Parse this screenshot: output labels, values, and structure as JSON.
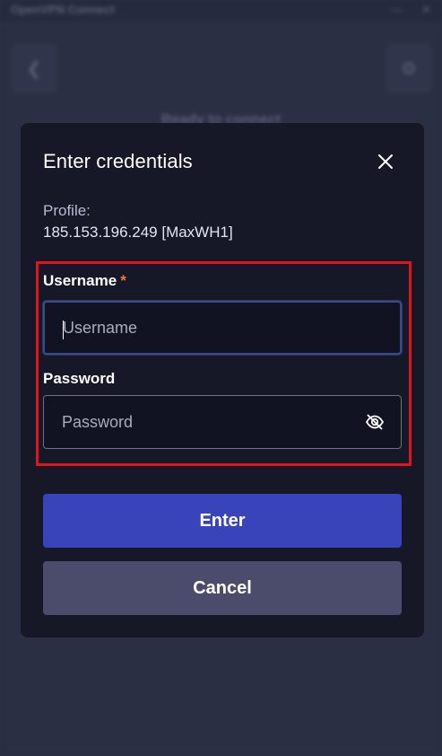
{
  "background": {
    "app_title": "OpenVPN Connect",
    "minimize_glyph": "—",
    "close_glyph": "✕",
    "back_glyph": "❮",
    "settings_glyph": "⚙",
    "heading": "Ready to connect"
  },
  "dialog": {
    "title": "Enter credentials",
    "profile_label": "Profile:",
    "profile_value": "185.153.196.249 [MaxWH1]",
    "username": {
      "label": "Username",
      "required_mark": "*",
      "value": "",
      "placeholder": "Username"
    },
    "password": {
      "label": "Password",
      "value": "",
      "placeholder": "Password"
    },
    "enter_button": "Enter",
    "cancel_button": "Cancel"
  },
  "colors": {
    "dialog_bg": "#161727",
    "primary_button": "#3944bb",
    "secondary_button": "#4b4b6c",
    "required_star": "#f07a3a",
    "highlight_border": "#e0141b"
  }
}
